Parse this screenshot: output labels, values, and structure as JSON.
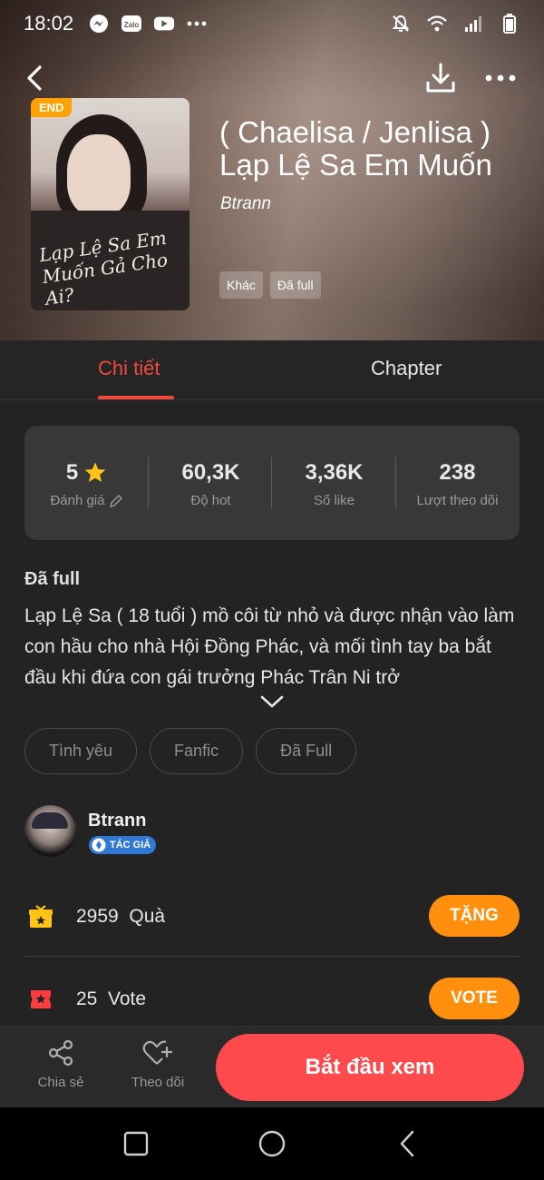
{
  "status_bar": {
    "time": "18:02",
    "apps": [
      "messenger-icon",
      "zalo-icon",
      "youtube-icon",
      "more-dots-icon"
    ],
    "zalo_label": "Zalo",
    "right_icons": [
      "mute-icon",
      "wifi-icon",
      "signal-icon",
      "battery-icon"
    ]
  },
  "story": {
    "badge": "END",
    "cover_script": "Lạp Lệ Sa Em Muốn Gả Cho Ai?",
    "title": "( Chaelisa / Jenlisa ) Lạp Lệ Sa Em Muốn",
    "author": "Btrann",
    "tags": [
      "Khác",
      "Đã full"
    ]
  },
  "tabs": [
    {
      "label": "Chi tiết",
      "active": true
    },
    {
      "label": "Chapter",
      "active": false
    }
  ],
  "stats": [
    {
      "value": "5",
      "label": "Đánh giá"
    },
    {
      "value": "60,3K",
      "label": "Độ hot"
    },
    {
      "value": "3,36K",
      "label": "Số like"
    },
    {
      "value": "238",
      "label": "Lượt theo dõi"
    }
  ],
  "description": {
    "status": "Đã full",
    "text": "Lạp Lệ Sa ( 18 tuổi ) mồ côi từ nhỏ và được nhận vào làm con hầu cho nhà Hội Đồng Phác, và mối tình tay ba bắt đầu khi đứa con gái trưởng Phác Trân Ni trở"
  },
  "genres": [
    "Tình yêu",
    "Fanfic",
    "Đã Full"
  ],
  "author_card": {
    "name": "Btrann",
    "badge": "TÁC GIẢ"
  },
  "gifts": {
    "count": "2959",
    "unit": "Quà",
    "button": "TẶNG"
  },
  "votes": {
    "count": "25",
    "unit": "Vote",
    "button": "VOTE"
  },
  "actions": {
    "share": "Chia sẻ",
    "follow": "Theo dõi",
    "start": "Bắt đầu xem"
  },
  "colors": {
    "accent": "#f3483f",
    "orange": "#ff8f0d",
    "start": "#fe4a4c",
    "badge": "#ffa200"
  }
}
